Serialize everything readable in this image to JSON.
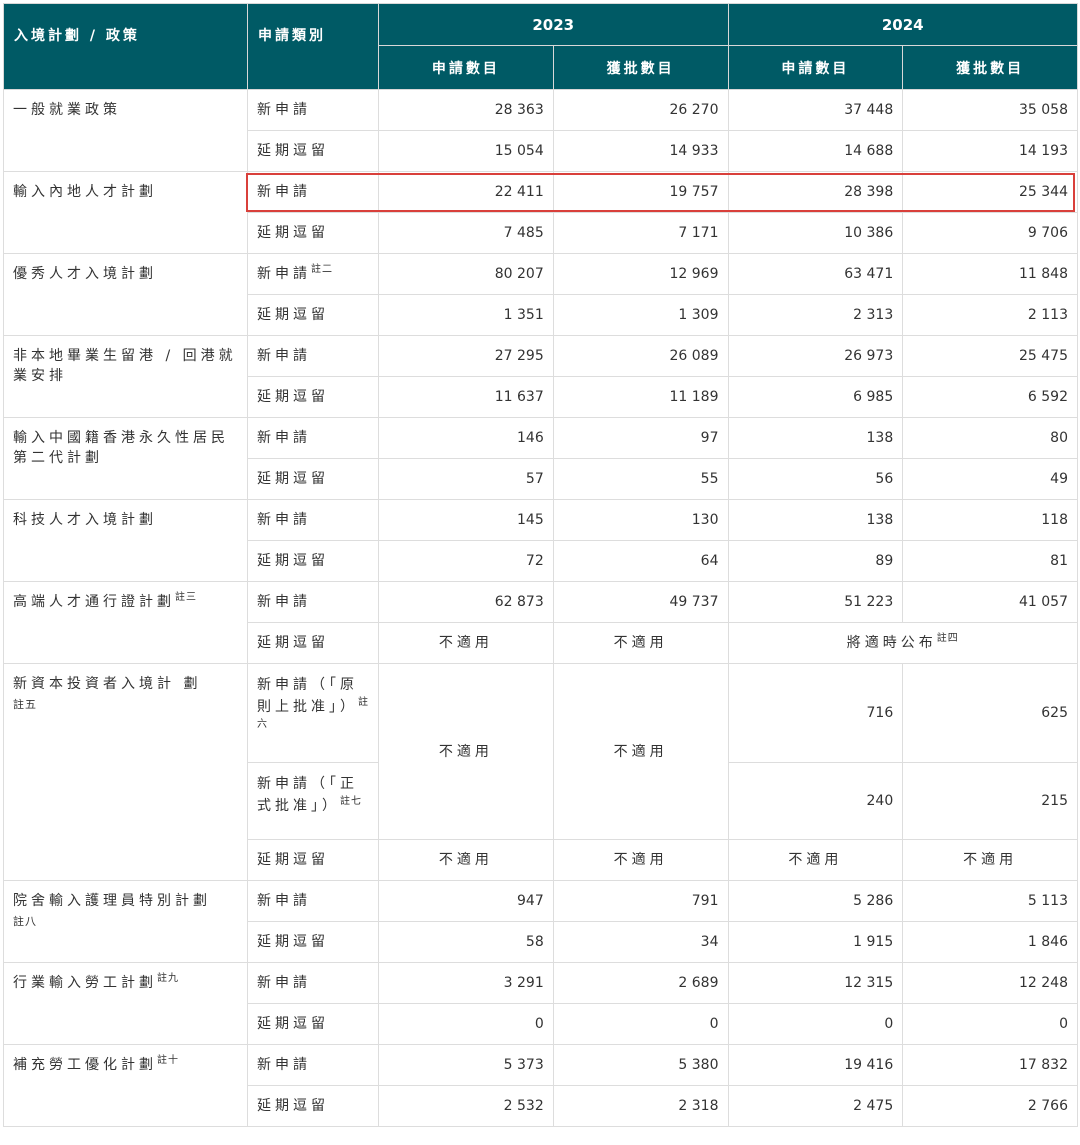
{
  "headers": {
    "scheme": "入境計劃 / 政策",
    "category": "申請類別",
    "year_2023": "2023",
    "year_2024": "2024",
    "applications": "申請數目",
    "approved": "獲批數目"
  },
  "note_marks": {
    "n2": "註二",
    "n3": "註三",
    "n4": "註四",
    "n5": "註五",
    "n6": "註六",
    "n7": "註七",
    "n8": "註八",
    "n9": "註九",
    "n10": "註十"
  },
  "labels": {
    "new": "新申請",
    "extension": "延期逗留",
    "na": "不適用",
    "to_be_announced": "將適時公布",
    "new_aip": "新申請（「原則上批准」）",
    "new_formal": "新申請（「正式批准」）"
  },
  "schemes": [
    {
      "name": "一般就業政策",
      "new": [
        "28 363",
        "26 270",
        "37 448",
        "35 058"
      ],
      "ext": [
        "15 054",
        "14 933",
        "14 688",
        "14 193"
      ]
    },
    {
      "name": "輸入內地人才計劃",
      "new": [
        "22 411",
        "19 757",
        "28 398",
        "25 344"
      ],
      "ext": [
        "7 485",
        "7 171",
        "10 386",
        "9 706"
      ]
    },
    {
      "name": "優秀人才入境計劃",
      "new": [
        "80 207",
        "12 969",
        "63 471",
        "11 848"
      ],
      "ext": [
        "1 351",
        "1 309",
        "2 313",
        "2 113"
      ]
    },
    {
      "name": "非本地畢業生留港 / 回港就業安排",
      "new": [
        "27 295",
        "26 089",
        "26 973",
        "25 475"
      ],
      "ext": [
        "11 637",
        "11 189",
        "6 985",
        "6 592"
      ]
    },
    {
      "name": "輸入中國籍香港永久性居民第二代計劃",
      "new": [
        "146",
        "97",
        "138",
        "80"
      ],
      "ext": [
        "57",
        "55",
        "56",
        "49"
      ]
    },
    {
      "name": "科技人才入境計劃",
      "new": [
        "145",
        "130",
        "138",
        "118"
      ],
      "ext": [
        "72",
        "64",
        "89",
        "81"
      ]
    },
    {
      "name": "高端人才通行證計劃",
      "new": [
        "62 873",
        "49 737",
        "51 223",
        "41 057"
      ]
    },
    {
      "name": "新資本投資者入境計 劃",
      "aip": [
        "716",
        "625"
      ],
      "formal": [
        "240",
        "215"
      ]
    },
    {
      "name": "院舍輸入護理員特別計劃",
      "new": [
        "947",
        "791",
        "5 286",
        "5 113"
      ],
      "ext": [
        "58",
        "34",
        "1 915",
        "1 846"
      ]
    },
    {
      "name": "行業輸入勞工計劃",
      "new": [
        "3 291",
        "2 689",
        "12 315",
        "12 248"
      ],
      "ext": [
        "0",
        "0",
        "0",
        "0"
      ]
    },
    {
      "name": "補充勞工優化計劃",
      "new": [
        "5 373",
        "5 380",
        "19 416",
        "17 832"
      ],
      "ext": [
        "2 532",
        "2 318",
        "2 475",
        "2 766"
      ]
    }
  ],
  "highlight": {
    "color": "#d9403b"
  },
  "colors": {
    "header_bg": "#005a65",
    "header_text": "#ffffff",
    "border": "#dddddd"
  }
}
